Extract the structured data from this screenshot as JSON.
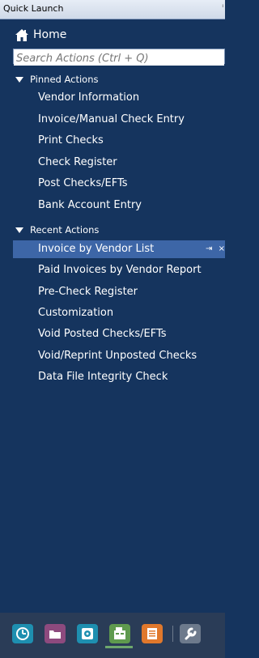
{
  "panel": {
    "title": "Quick Launch",
    "pin_glyph": "ᵢ"
  },
  "home": {
    "label": "Home",
    "icon": "home-icon"
  },
  "search": {
    "placeholder": "Search Actions (Ctrl + Q)"
  },
  "pinned": {
    "header": "Pinned Actions",
    "items": [
      {
        "label": "Vendor Information"
      },
      {
        "label": "Invoice/Manual Check Entry"
      },
      {
        "label": "Print Checks"
      },
      {
        "label": "Check Register"
      },
      {
        "label": "Post Checks/EFTs"
      },
      {
        "label": "Bank Account Entry"
      }
    ]
  },
  "recent": {
    "header": "Recent Actions",
    "items": [
      {
        "label": "Invoice by Vendor List",
        "selected": true,
        "pin_glyph": "⇥",
        "close_glyph": "×"
      },
      {
        "label": "Paid Invoices by Vendor Report"
      },
      {
        "label": "Pre-Check Register"
      },
      {
        "label": "Customization"
      },
      {
        "label": "Void Posted Checks/EFTs"
      },
      {
        "label": "Void/Reprint Unposted Checks"
      },
      {
        "label": "Data File Integrity Check"
      }
    ]
  },
  "toolbar": {
    "buttons": [
      {
        "icon": "dashboard-icon",
        "color": "#1e8fb0"
      },
      {
        "icon": "folder-icon",
        "color": "#8d4a7e"
      },
      {
        "icon": "target-icon",
        "color": "#1e8fb0"
      },
      {
        "icon": "register-icon",
        "color": "#5f9a4e",
        "active": true
      },
      {
        "icon": "list-icon",
        "color": "#e0782c"
      },
      {
        "icon": "wrench-icon",
        "color": "#6d7a8c"
      }
    ],
    "active_color": "#6ea86d"
  },
  "colors": {
    "background": "#15345e",
    "selected": "#3d66a7",
    "titlebar": "#dde5f1"
  }
}
